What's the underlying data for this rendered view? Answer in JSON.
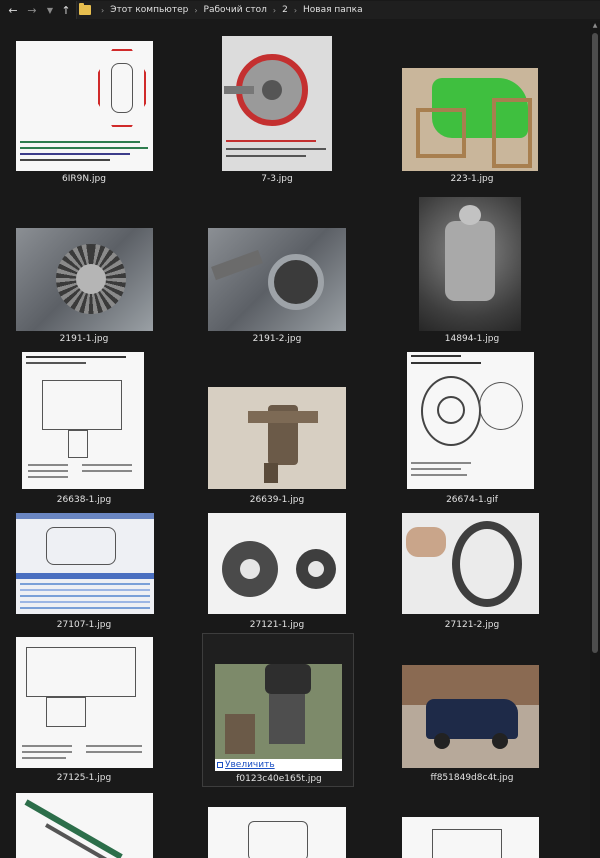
{
  "nav": {
    "back_icon": "arrow-left-icon",
    "forward_icon": "arrow-right-icon",
    "recent_icon": "chevron-down-icon",
    "up_icon": "arrow-up-icon"
  },
  "breadcrumb": [
    "Этот компьютер",
    "Рабочий стол",
    "2",
    "Новая папка"
  ],
  "files": [
    {
      "name": "6IR9N.jpg"
    },
    {
      "name": "7-3.jpg"
    },
    {
      "name": "223-1.jpg"
    },
    {
      "name": "2191-1.jpg"
    },
    {
      "name": "2191-2.jpg"
    },
    {
      "name": "14894-1.jpg"
    },
    {
      "name": "26638-1.jpg"
    },
    {
      "name": "26639-1.jpg"
    },
    {
      "name": "26674-1.gif"
    },
    {
      "name": "27107-1.jpg"
    },
    {
      "name": "27121-1.jpg"
    },
    {
      "name": "27121-2.jpg"
    },
    {
      "name": "27125-1.jpg"
    },
    {
      "name": "f0123c40e165t.jpg",
      "overlay_link": "Увеличить"
    },
    {
      "name": "ff851849d8c4t.jpg"
    },
    {
      "name": ""
    },
    {
      "name": ""
    },
    {
      "name": ""
    }
  ],
  "colors": {
    "background": "#191919",
    "text": "#e6e6e6",
    "folder": "#e8bf4f",
    "link": "#1b4fc2"
  }
}
